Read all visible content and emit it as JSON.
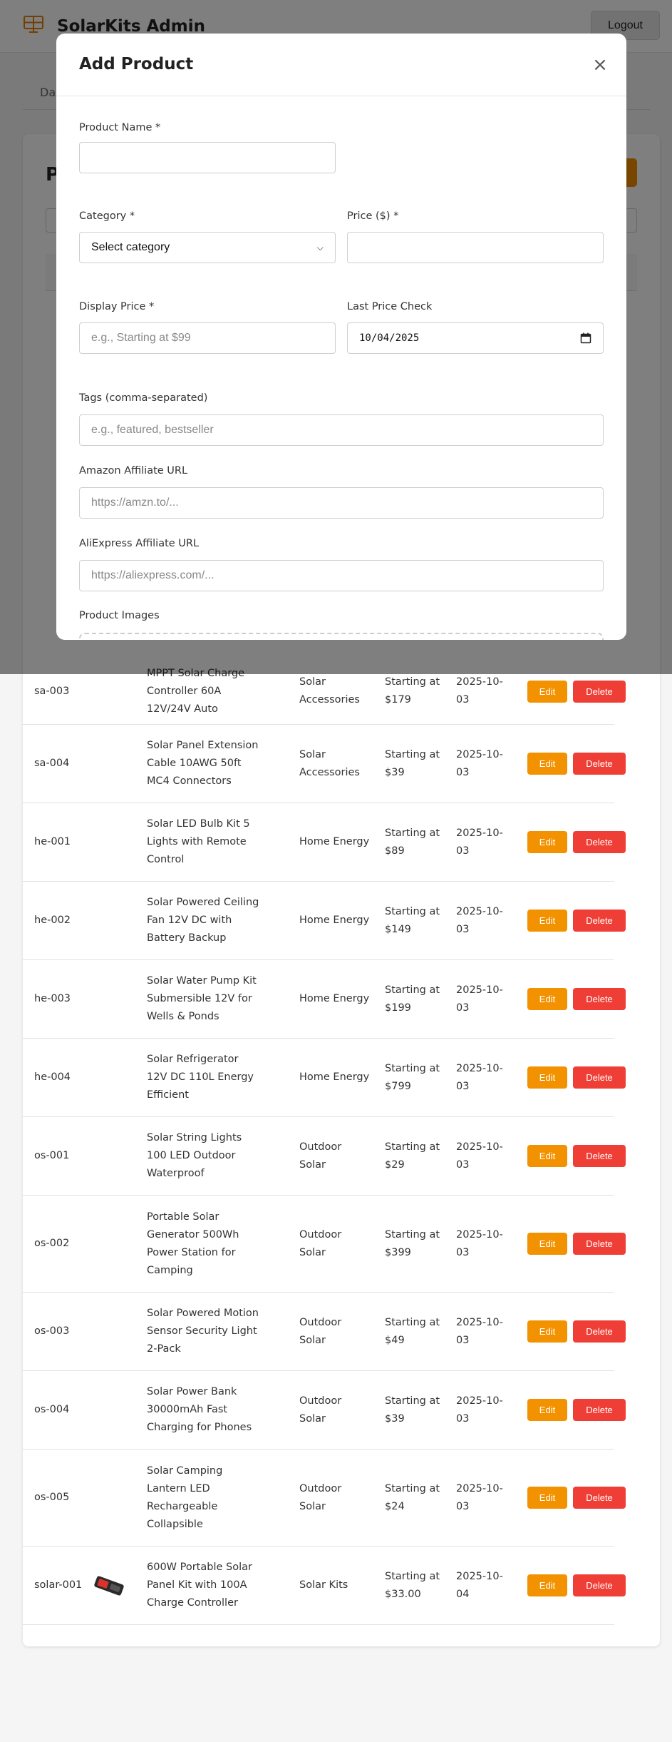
{
  "app": {
    "title": "SolarKits Admin",
    "logout_label": "Logout",
    "tab_label": "Das"
  },
  "card": {
    "title_partial": "P"
  },
  "colors": {
    "accent": "#f39200",
    "danger": "#ef3e36",
    "overlay": "rgba(0,0,0,0.5)"
  },
  "modal": {
    "title": "Add Product",
    "close_label": "×",
    "fields": {
      "name_label": "Product Name *",
      "category_label": "Category *",
      "category_value": "Select category",
      "price_label": "Price ($) *",
      "display_price_label": "Display Price *",
      "display_price_placeholder": "e.g., Starting at $99",
      "last_check_label": "Last Price Check",
      "last_check_value": "10/04/2025",
      "tags_label": "Tags (comma-separated)",
      "tags_placeholder": "e.g., featured, bestseller",
      "amazon_label": "Amazon Affiliate URL",
      "amazon_placeholder": "https://amzn.to/...",
      "aliexpress_label": "AliExpress Affiliate URL",
      "aliexpress_placeholder": "https://aliexpress.com/...",
      "images_label": "Product Images"
    }
  },
  "table": {
    "edit_label": "Edit",
    "delete_label": "Delete",
    "rows": [
      {
        "id": "sa-003",
        "name": "MPPT Solar Charge Controller 60A 12V/24V Auto",
        "category": "Solar Accessories",
        "price": "Starting at $179",
        "date": "2025-10-03"
      },
      {
        "id": "sa-004",
        "name": "Solar Panel Extension Cable 10AWG 50ft MC4 Connectors",
        "category": "Solar Accessories",
        "price": "Starting at $39",
        "date": "2025-10-03"
      },
      {
        "id": "he-001",
        "name": "Solar LED Bulb Kit 5 Lights with Remote Control",
        "category": "Home Energy",
        "price": "Starting at $89",
        "date": "2025-10-03"
      },
      {
        "id": "he-002",
        "name": "Solar Powered Ceiling Fan 12V DC with Battery Backup",
        "category": "Home Energy",
        "price": "Starting at $149",
        "date": "2025-10-03"
      },
      {
        "id": "he-003",
        "name": "Solar Water Pump Kit Submersible 12V for Wells & Ponds",
        "category": "Home Energy",
        "price": "Starting at $199",
        "date": "2025-10-03"
      },
      {
        "id": "he-004",
        "name": "Solar Refrigerator 12V DC 110L Energy Efficient",
        "category": "Home Energy",
        "price": "Starting at $799",
        "date": "2025-10-03"
      },
      {
        "id": "os-001",
        "name": "Solar String Lights 100 LED Outdoor Waterproof",
        "category": "Outdoor Solar",
        "price": "Starting at $29",
        "date": "2025-10-03"
      },
      {
        "id": "os-002",
        "name": "Portable Solar Generator 500Wh Power Station for Camping",
        "category": "Outdoor Solar",
        "price": "Starting at $399",
        "date": "2025-10-03"
      },
      {
        "id": "os-003",
        "name": "Solar Powered Motion Sensor Security Light 2-Pack",
        "category": "Outdoor Solar",
        "price": "Starting at $49",
        "date": "2025-10-03"
      },
      {
        "id": "os-004",
        "name": "Solar Power Bank 30000mAh Fast Charging for Phones",
        "category": "Outdoor Solar",
        "price": "Starting at $39",
        "date": "2025-10-03"
      },
      {
        "id": "os-005",
        "name": "Solar Camping Lantern LED Rechargeable Collapsible",
        "category": "Outdoor Solar",
        "price": "Starting at $24",
        "date": "2025-10-03"
      },
      {
        "id": "solar-001",
        "name": "600W Portable Solar Panel Kit with 100A Charge Controller",
        "category": "Solar Kits",
        "price": "Starting at $33.00",
        "date": "2025-10-04",
        "has_image": true
      }
    ]
  }
}
